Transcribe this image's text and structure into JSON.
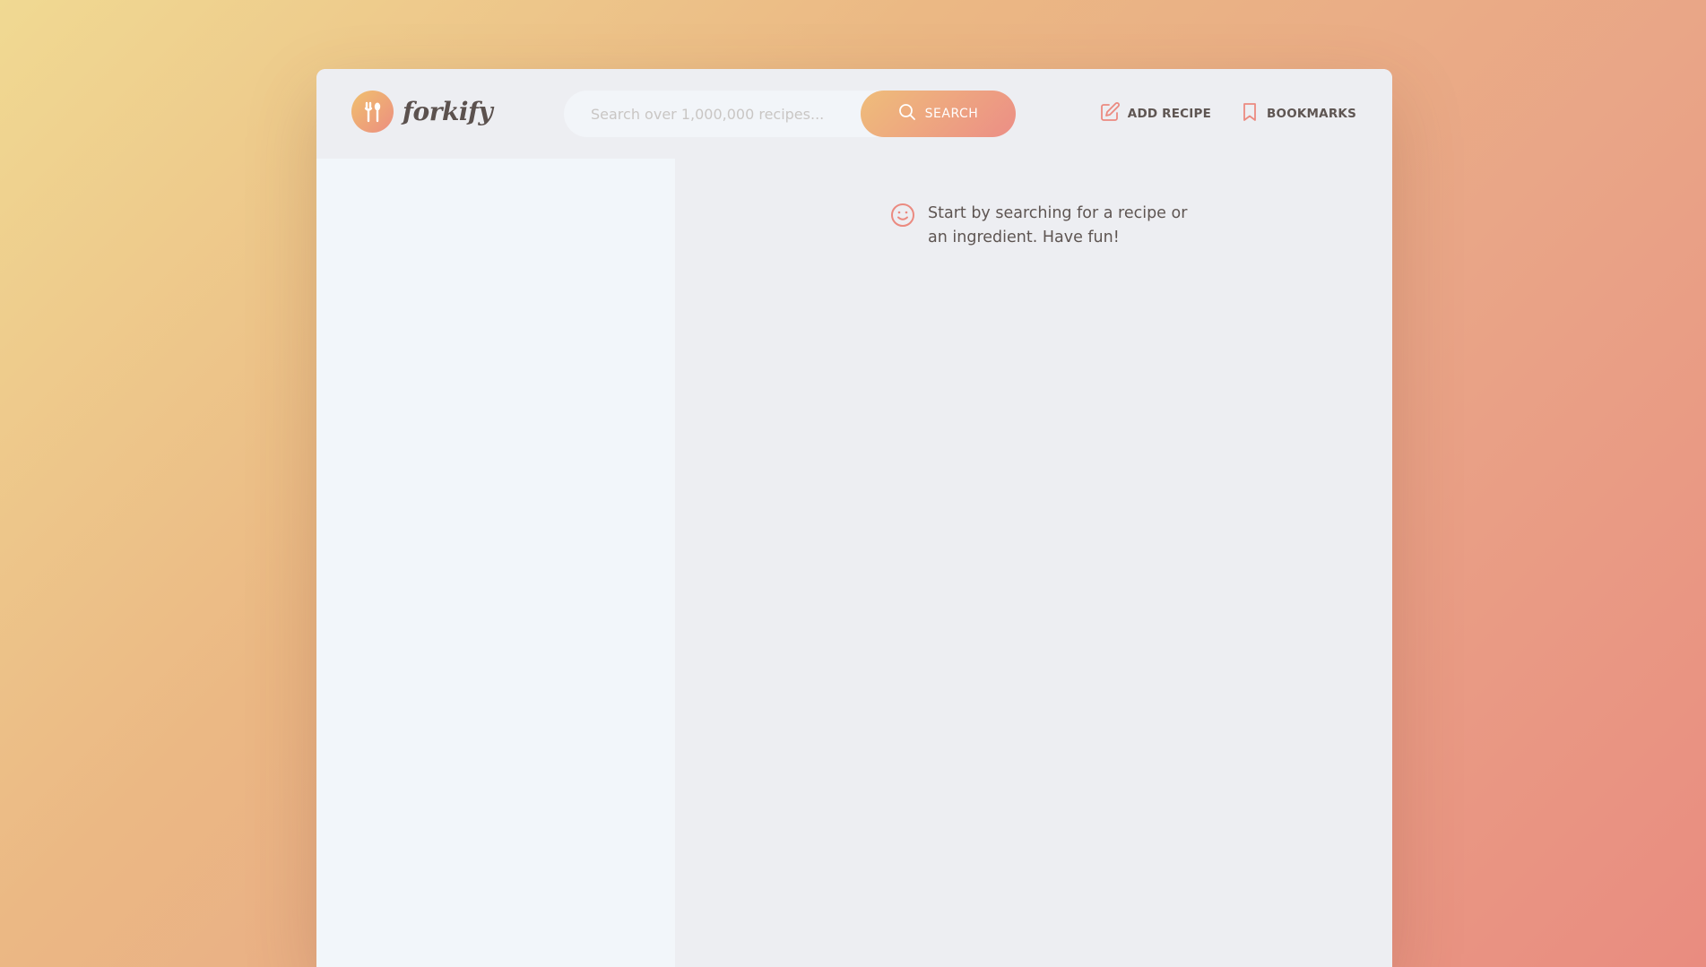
{
  "app": {
    "brand": "forkify"
  },
  "header": {
    "search": {
      "placeholder": "Search over 1,000,000 recipes...",
      "value": "",
      "button_label": "SEARCH"
    },
    "nav": {
      "add_recipe_label": "ADD RECIPE",
      "bookmarks_label": "BOOKMARKS"
    }
  },
  "main": {
    "message": "Start by searching for a recipe or an ingredient. Have fun!"
  },
  "icons": {
    "logo": "fork-spoon-icon",
    "search": "search-icon",
    "add_recipe": "edit-icon",
    "bookmarks": "bookmark-icon",
    "message": "smile-icon"
  },
  "colors": {
    "accent_start": "#f0c06e",
    "accent_end": "#ec8e80",
    "text": "#5e5552",
    "panel": "#edeef2",
    "sidebar": "#f2f6fa"
  }
}
